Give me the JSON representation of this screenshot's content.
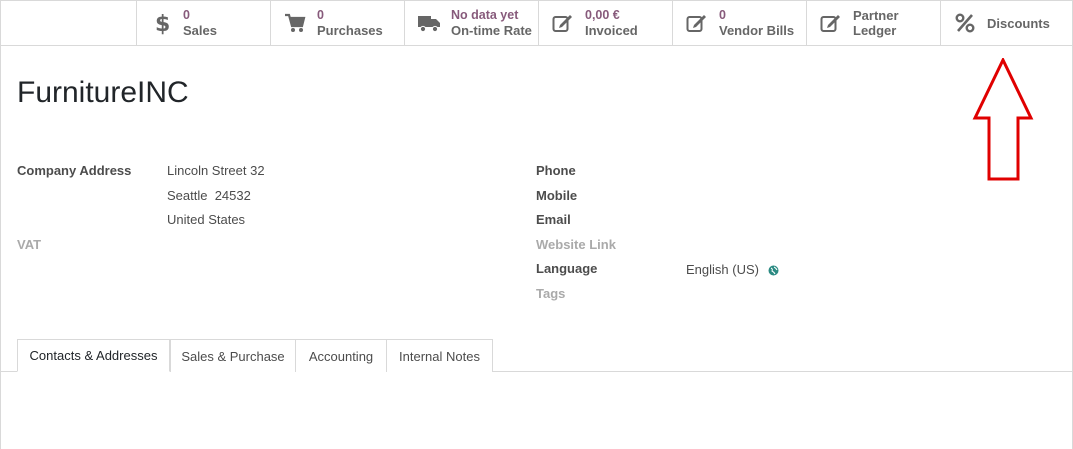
{
  "smart_buttons": [
    {
      "value": "0",
      "label": "Sales",
      "icon": "dollar-icon"
    },
    {
      "value": "0",
      "label": "Purchases",
      "icon": "cart-icon"
    },
    {
      "value": "No data yet",
      "label": "On-time Rate",
      "icon": "truck-icon"
    },
    {
      "value": "0,00 €",
      "label": "Invoiced",
      "icon": "edit-icon"
    },
    {
      "value": "0",
      "label": "Vendor Bills",
      "icon": "edit-icon"
    },
    {
      "line1": "Partner",
      "line2": "Ledger",
      "icon": "edit-icon"
    },
    {
      "label": "Discounts",
      "icon": "percent-icon"
    }
  ],
  "partner": {
    "name": "FurnitureINC",
    "company_address_label": "Company Address",
    "street": "Lincoln Street 32",
    "city_zip": "Seattle  24532",
    "country": "United States",
    "vat_label": "VAT",
    "phone_label": "Phone",
    "mobile_label": "Mobile",
    "email_label": "Email",
    "website_label": "Website Link",
    "language_label": "Language",
    "language_value": "English (US)",
    "tags_label": "Tags"
  },
  "tabs": [
    {
      "label": "Contacts & Addresses",
      "active": true
    },
    {
      "label": "Sales & Purchase"
    },
    {
      "label": "Accounting"
    },
    {
      "label": "Internal Notes"
    }
  ],
  "colors": {
    "accent": "#875a7b",
    "annotation_arrow": "#e00000",
    "globe": "#2a8a82"
  }
}
